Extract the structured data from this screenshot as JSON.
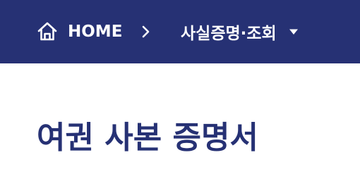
{
  "breadcrumb": {
    "home_label": "HOME",
    "home_icon": "home-icon",
    "separator_icon": "chevron-right-icon",
    "current_label": "사실증명·조회",
    "current_icon": "caret-down-icon"
  },
  "page": {
    "title": "여권 사본 증명서"
  },
  "colors": {
    "header_background": "#263174",
    "header_text": "#ffffff",
    "title_text": "#263174",
    "page_background": "#ffffff"
  }
}
